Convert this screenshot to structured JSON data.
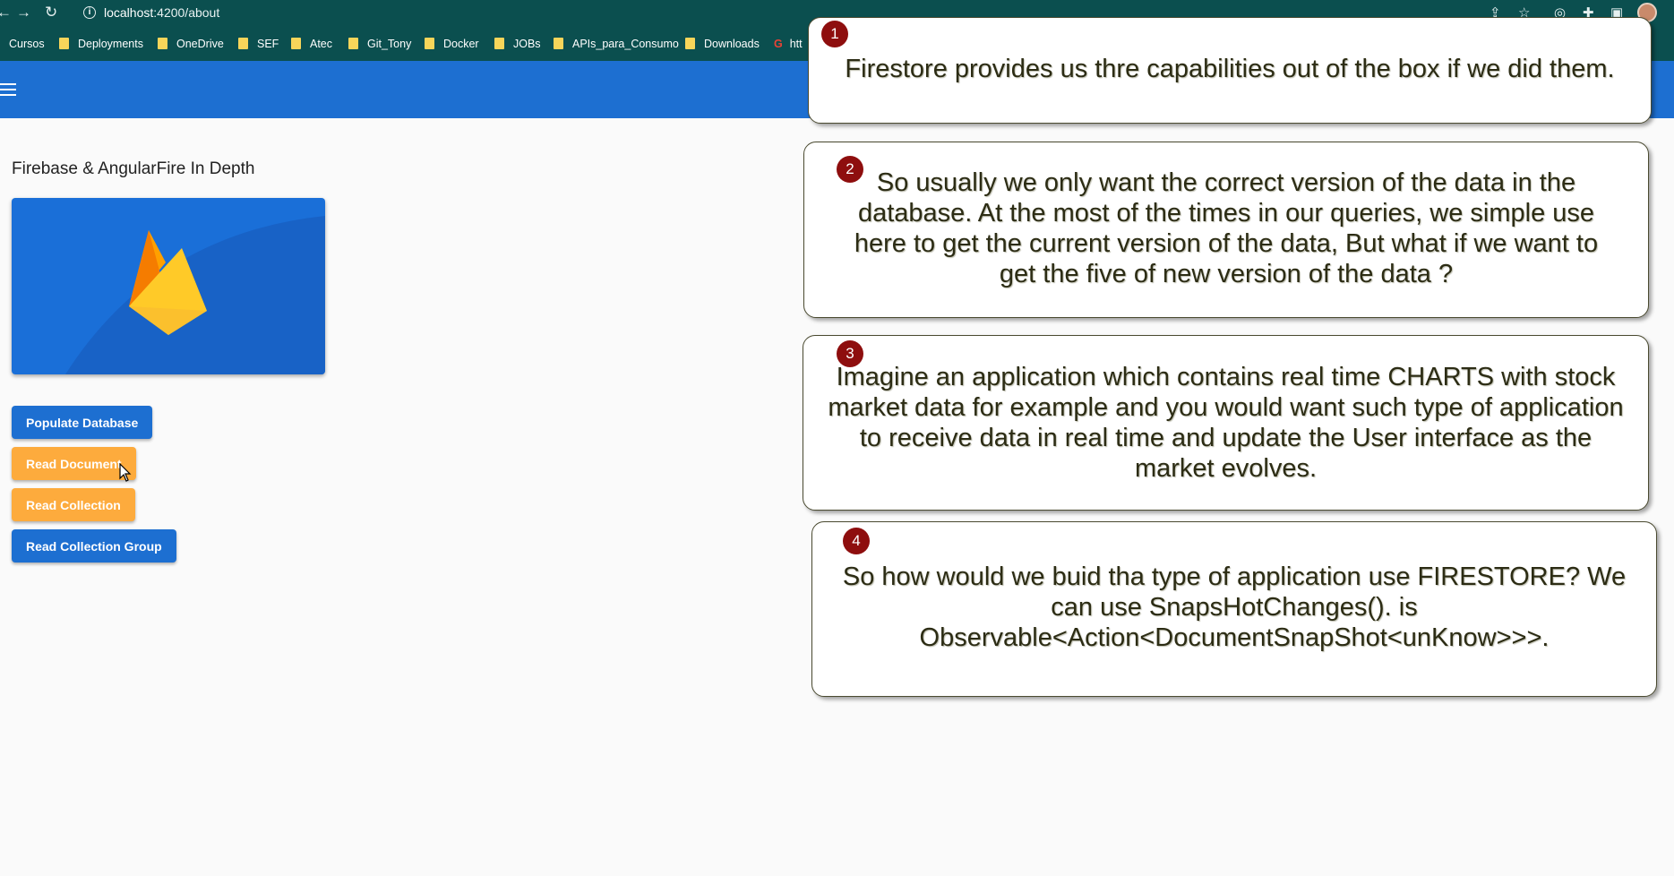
{
  "browser": {
    "url_host": "localhost",
    "url_path": ":4200/about",
    "bookmarks": [
      "Cursos",
      "Deployments",
      "OneDrive",
      "SEF",
      "Atec",
      "Git_Tony",
      "Docker",
      "JOBs",
      "APIs_para_Consumo",
      "Downloads",
      "htt"
    ]
  },
  "page": {
    "title": "Firebase & AngularFire In Depth",
    "buttons": {
      "populate": "Populate Database",
      "read_document": "Read Document",
      "read_collection": "Read Collection",
      "read_collection_group": "Read Collection Group"
    },
    "colors": {
      "toolbar": "#1d6fd1",
      "primary_button": "#1d6fd1",
      "accent_button": "#fdab3d",
      "browser_chrome": "#0b4f4f"
    }
  },
  "callouts": [
    {
      "number": "1",
      "text": "Firestore provides us thre capabilities out of the box if we did them."
    },
    {
      "number": "2",
      "text": "So usually we only want the correct version of the data in the database. At the most of the times in our  queries, we simple  use here to get the current version of the data, But what if we want to get the five of new version of the data ?"
    },
    {
      "number": "3",
      "text": "Imagine an application which contains real time CHARTS with stock market data for example and you would want such type of application to receive data in real time and update the User interface as the market evolves."
    },
    {
      "number": "4",
      "text": "So how would we buid tha type of application use FIRESTORE? We can use  SnapsHotChanges(). is Observable<Action<DocumentSnapShot<unKnow>>>."
    }
  ]
}
